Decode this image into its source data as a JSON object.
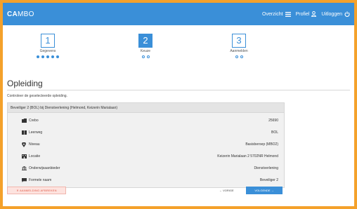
{
  "brand": {
    "bold": "CA",
    "rest": "MBO"
  },
  "nav": {
    "overzicht": "Overzicht",
    "profiel": "Profiel",
    "uitloggen": "Uitloggen"
  },
  "steps": [
    {
      "number": "1",
      "label": "Gegevens"
    },
    {
      "number": "2",
      "label": "Keuze"
    },
    {
      "number": "3",
      "label": "Aanmelden"
    }
  ],
  "page": {
    "title": "Opleiding",
    "intro": "Controleer de geselecteerde opleiding."
  },
  "panel": {
    "heading": "Beveiliger 2 (BOL) bij Dienstverlening (Helmond, Keizerin Marialaan)",
    "rows": [
      {
        "icon": "folder-icon",
        "key": "Crebo",
        "value": "25690"
      },
      {
        "icon": "book-icon",
        "key": "Leerweg",
        "value": "BOL"
      },
      {
        "icon": "map-marker-icon",
        "key": "Niveau",
        "value": "Basisberoep (MBO2)"
      },
      {
        "icon": "building-icon",
        "key": "Locatie",
        "value": "Keizerin Marialaan 2 5702NR Helmond"
      },
      {
        "icon": "institution-icon",
        "key": "Onderwijsaanbieder",
        "value": "Dienstverlening"
      },
      {
        "icon": "comment-icon",
        "key": "Formele naam",
        "value": "Beveiliger 2"
      }
    ]
  },
  "footer": {
    "cancel": "✕ AANMELDING AFBREKEN",
    "prev": "← VORIGE",
    "next": "VOLGENDE →"
  },
  "colors": {
    "primary": "#3a8fd8",
    "frame": "#f4a12b",
    "danger": "#e05a48"
  }
}
